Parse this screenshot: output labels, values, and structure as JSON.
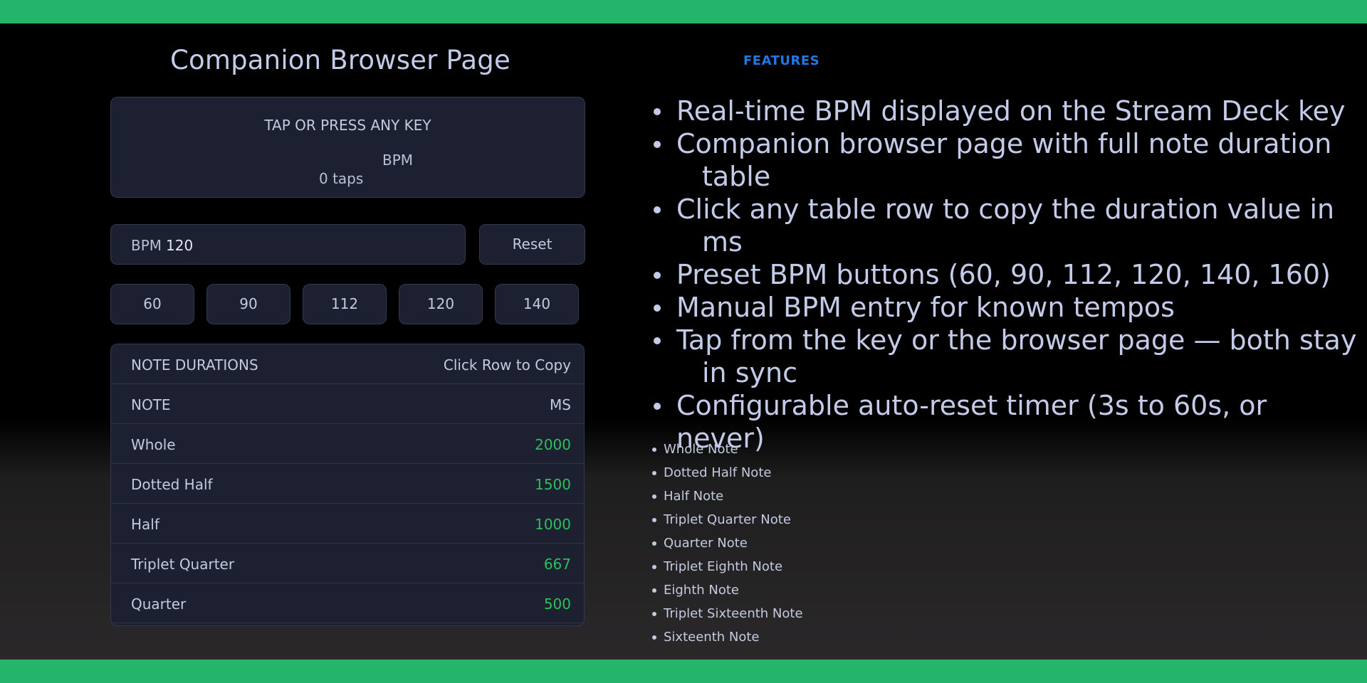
{
  "page_title": "Companion Browser Page",
  "tap_panel": {
    "instruction": "TAP OR PRESS ANY KEY",
    "bpm_label": "BPM",
    "tap_count": "0 taps"
  },
  "bpm_input": {
    "label": "BPM",
    "value": "120"
  },
  "reset_label": "Reset",
  "presets": [
    "60",
    "90",
    "112",
    "120",
    "140"
  ],
  "note_table": {
    "title": "NOTE DURATIONS",
    "hint": "Click Row to Copy",
    "columns": [
      "NOTE",
      "MS"
    ],
    "rows": [
      {
        "note": "Whole",
        "ms": "2000"
      },
      {
        "note": "Dotted Half",
        "ms": "1500"
      },
      {
        "note": "Half",
        "ms": "1000"
      },
      {
        "note": "Triplet Quarter",
        "ms": "667"
      },
      {
        "note": "Quarter",
        "ms": "500"
      }
    ]
  },
  "features_heading": "FEATURES",
  "features": [
    {
      "line1": "Real-time BPM displayed on the Stream Deck key",
      "line2": ""
    },
    {
      "line1": "Companion browser page with full note duration",
      "line2": "table"
    },
    {
      "line1": "Click any table row to copy the duration value in",
      "line2": "ms"
    },
    {
      "line1": "Preset BPM buttons (60, 90, 112, 120, 140, 160)",
      "line2": ""
    },
    {
      "line1": "Manual BPM entry for known tempos",
      "line2": ""
    },
    {
      "line1": "Tap from the key or the browser page — both stay",
      "line2": "in sync"
    },
    {
      "line1": "Configurable auto-reset timer (3s to 60s, or never)",
      "line2": ""
    }
  ],
  "note_types": [
    "Whole Note",
    "Dotted Half Note",
    "Half Note",
    "Triplet Quarter Note",
    "Quarter Note",
    "Triplet Eighth Note",
    "Eighth Note",
    "Triplet Sixteenth Note",
    "Sixteenth Note"
  ],
  "colors": {
    "frame_green": "#24b46a",
    "panel_bg": "#1c2030",
    "ms_value_green": "#2fbf5a",
    "features_blue": "#1f78e6"
  }
}
